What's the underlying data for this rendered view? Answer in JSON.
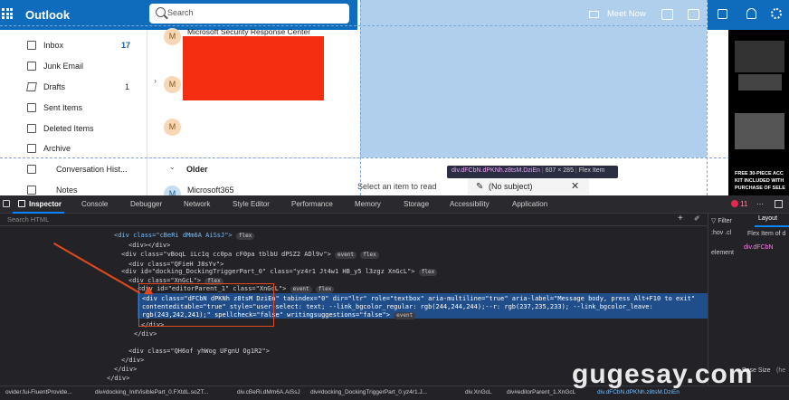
{
  "outlook": {
    "brand": "Outlook",
    "search_placeholder": "Search",
    "meet_label": "Meet Now",
    "nav": [
      {
        "label": "Inbox",
        "count": "17"
      },
      {
        "label": "Junk Email",
        "count": ""
      },
      {
        "label": "Drafts",
        "count": "1"
      },
      {
        "label": "Sent Items",
        "count": ""
      },
      {
        "label": "Deleted Items",
        "count": ""
      },
      {
        "label": "Archive",
        "count": ""
      },
      {
        "label": "Conversation Hist...",
        "count": ""
      },
      {
        "label": "Notes",
        "count": ""
      }
    ],
    "list": {
      "sender1": "Microsoft Security Response Center",
      "avatar_initial": "M",
      "group_older": "Older",
      "sender3": "Microsoft365"
    },
    "reading": {
      "empty_text": "Select an item to read",
      "subject": "(No subject)"
    },
    "tooltip": {
      "selector": "div.dFCbN.dPKNh.z8tsM.DziEn",
      "size": "607 × 285",
      "kind": "Flex Item"
    },
    "ad_text": "FREE 30-PIECE ACC KIT INCLUDED WITH PURCHASE OF SELE"
  },
  "devtools": {
    "tabs": [
      "Inspector",
      "Console",
      "Debugger",
      "Network",
      "Style Editor",
      "Performance",
      "Memory",
      "Storage",
      "Accessibility",
      "Application"
    ],
    "search_placeholder": "Search HTML",
    "error_count": "11",
    "right_tabs": {
      "layout": "Layout"
    },
    "right_lines": [
      ":hov .cl",
      "Flex Item of d",
      "div.dFCbN",
      "element",
      "Base Size",
      "(he"
    ],
    "lines": [
      "<div class=\"cBeRi dMm6A AiSsJ\">",
      "<div></div>",
      "<div class=\"vBoqL iLc1q cc0pa cF0pa tblbU dPSZ2 ADl9v\">",
      "<div class=\"QFieH J8sYv\">",
      "<div id=\"docking_DockingTriggerPart_0\" class=\"yz4r1 Jt4w1 HB_y5 l3zgz XnGcL\">",
      "<div class=\"XnGcL\">",
      "<div id=\"editorParent_1\" class=\"XnGcL\">",
      "<div class=\"dFCbN dPKNh z8tsM DziEn\" tabindex=\"0\" dir=\"ltr\" role=\"textbox\" aria-multiline=\"true\" aria-label=\"Message body, press Alt+F10 to exit\"",
      "contenteditable=\"true\" style=\"user-select: text; --link_bgcolor_regular: rgb(244,244,244);--r: rgb(237,235,233); --link_bgcolor_leave:",
      "rgb(243,242,241);\" spellcheck=\"false\" writingsuggestions=\"false\">",
      "</div>",
      "</div>",
      "<div class=\"QH6of yhWog UFgnU Og1R2\">",
      "</div>",
      "</div>",
      "</div>"
    ],
    "badges": {
      "flex": "flex",
      "event": "event"
    },
    "breadcrumbs": [
      "ovider.fui-FluentProvide...",
      "div#docking_InitVisiblePart_0.FXtdL.soZT...",
      "div.cBeRi.dMm6A.AiSsJ",
      "div#docking_DockingTriggerPart_0.yz4r1.J...",
      "div.XnGcL",
      "div#editorParent_1.XnGcL",
      "div.dFCbN.dPKNh.z8tsM.DziEn"
    ]
  },
  "watermark": "gugesay.com"
}
